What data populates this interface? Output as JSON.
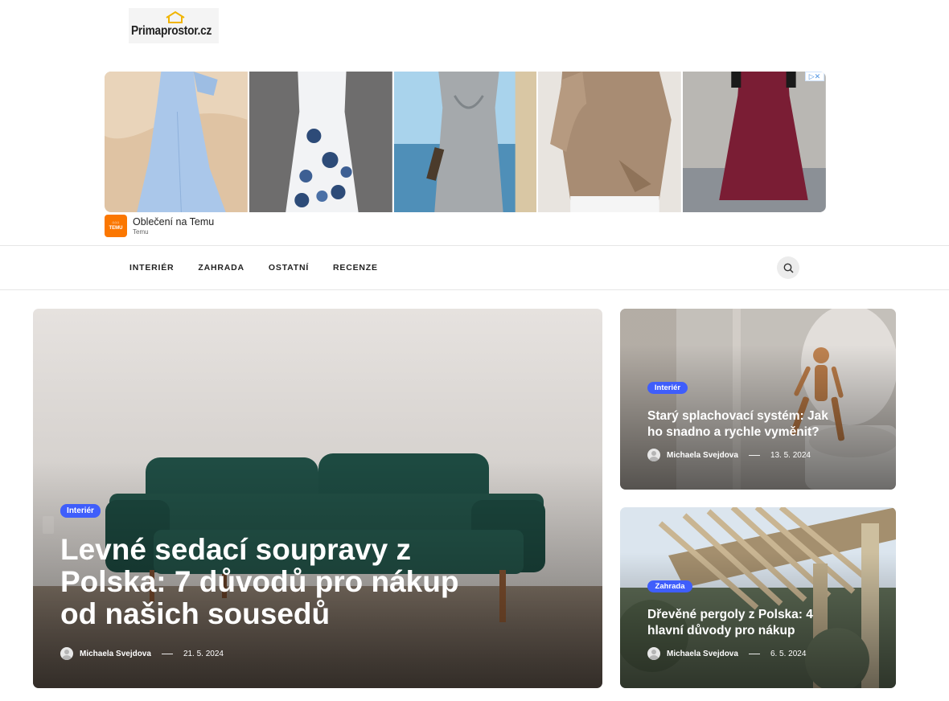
{
  "site": {
    "logo_text": "Primaprostor.cz"
  },
  "ad": {
    "title": "Oblečení na Temu",
    "advertiser": "Temu",
    "logo_text": "TEMU",
    "badge_icon": "adchoices-icon"
  },
  "nav": {
    "items": [
      "INTERIÉR",
      "ZAHRADA",
      "OSTATNÍ",
      "RECENZE"
    ],
    "search_icon": "search-icon"
  },
  "featured": {
    "tag": "Interiér",
    "title": "Levné sedací soupravy z Polska: 7 důvodů pro nákup od našich sousedů",
    "author": "Michaela Svejdova",
    "date": "21. 5. 2024"
  },
  "side_posts": [
    {
      "tag": "Interiér",
      "title": "Starý splachovací systém: Jak ho snadno a rychle vyměnit?",
      "author": "Michaela Svejdova",
      "date": "13. 5. 2024"
    },
    {
      "tag": "Zahrada",
      "title": "Dřevěné pergoly z Polska: 4 hlavní důvody pro nákup",
      "author": "Michaela Svejdova",
      "date": "6. 5. 2024"
    }
  ],
  "colors": {
    "tag_blue": "#3f5efb",
    "temu_orange": "#fb7701"
  }
}
